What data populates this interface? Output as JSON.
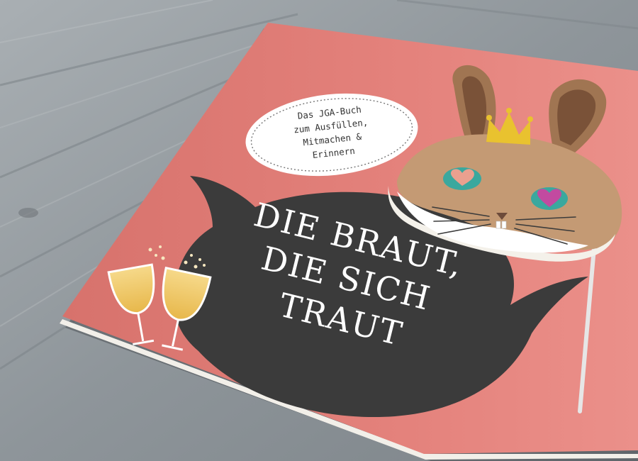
{
  "book": {
    "cover_color": "#e4827c",
    "title_lines": [
      "DIE BRAUT,",
      "DIE SICH",
      "TRAUT"
    ],
    "subtitle_lines": [
      "Das JGA-Buch",
      "zum Ausfüllen,",
      "Mitmachen &",
      "Erinnern"
    ]
  },
  "illustrations": {
    "mask": "bunny-mask-with-crown",
    "speech_bubble": "cat-shaped-speech-bubble",
    "glasses": "champagne-glasses"
  },
  "colors": {
    "wood": "#9aa0a4",
    "chalkboard": "#3b3b3b",
    "bunny_fur": "#c49a74",
    "crown": "#e9c22f"
  }
}
